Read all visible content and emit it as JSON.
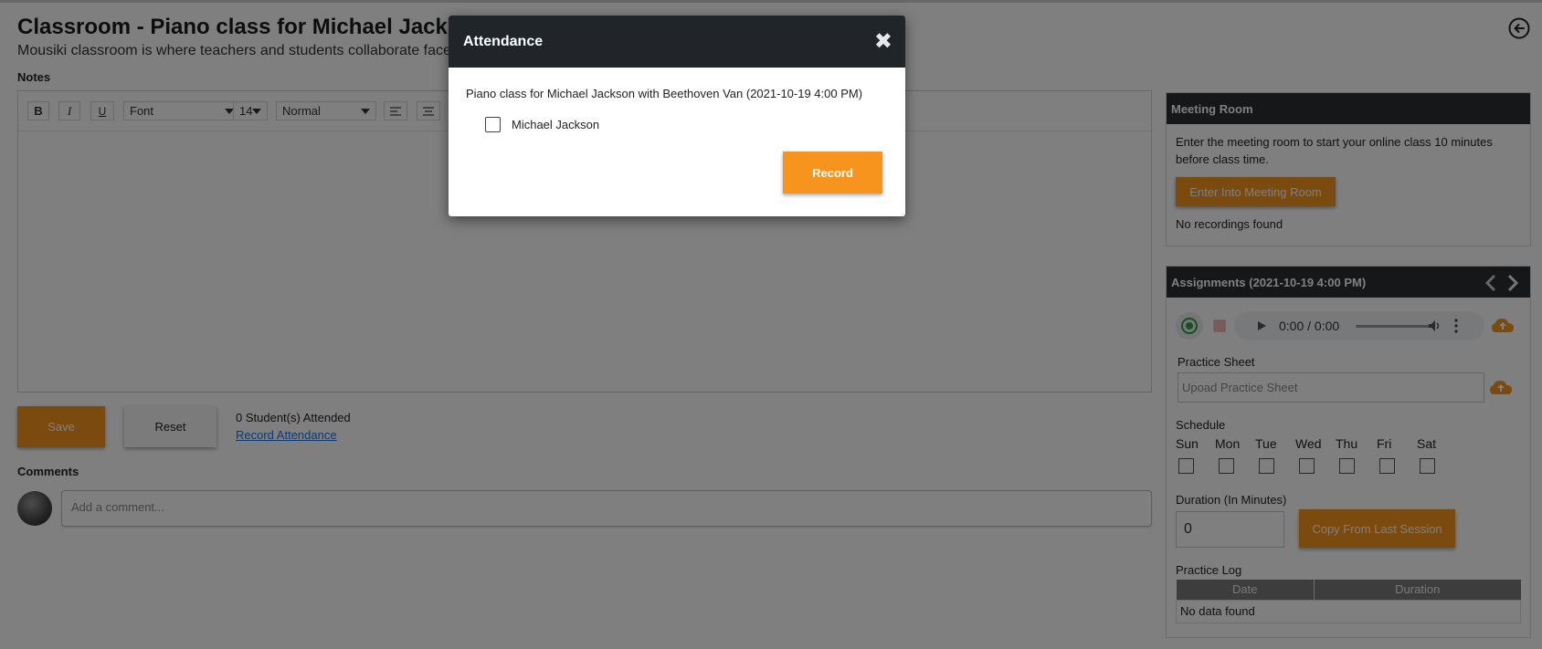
{
  "page": {
    "title": "Classroom - Piano class for Michael Jackson",
    "subtitle": "Mousiki classroom is where teachers and students collaborate face to face online, share practice sheets, audio files, and record progress."
  },
  "notes": {
    "label": "Notes",
    "toolbar": {
      "bold": "B",
      "italic": "I",
      "underline": "U",
      "font": "Font",
      "size": "14",
      "style": "Normal"
    }
  },
  "actions": {
    "save_label": "Save",
    "reset_label": "Reset",
    "attended_text": "0 Student(s) Attended",
    "record_attendance_link": "Record Attendance"
  },
  "comments": {
    "label": "Comments",
    "placeholder": "Add a comment..."
  },
  "meeting_room": {
    "title": "Meeting Room",
    "description": "Enter the meeting room to start your online class 10 minutes before class time.",
    "enter_button": "Enter Into Meeting Room",
    "no_recordings": "No recordings found"
  },
  "assignments": {
    "title": "Assignments (2021-10-19 4:00 PM)",
    "audio_time": "0:00 / 0:00",
    "practice_sheet_label": "Practice Sheet",
    "practice_sheet_placeholder": "Upoad Practice Sheet",
    "schedule_label": "Schedule",
    "days": [
      "Sun",
      "Mon",
      "Tue",
      "Wed",
      "Thu",
      "Fri",
      "Sat"
    ],
    "duration_label": "Duration (In Minutes)",
    "duration_value": "0",
    "copy_button": "Copy From Last Session",
    "practice_log_label": "Practice Log",
    "log_columns": [
      "Date",
      "Duration"
    ],
    "log_empty": "No data found"
  },
  "modal": {
    "title": "Attendance",
    "close_symbol": "✖",
    "class_info": "Piano class for Michael Jackson with Beethoven Van (2021-10-19 4:00 PM)",
    "student": "Michael Jackson",
    "record_button": "Record"
  },
  "colors": {
    "accent": "#f7941d",
    "header_dark": "#212529",
    "link": "#1a73e8"
  }
}
